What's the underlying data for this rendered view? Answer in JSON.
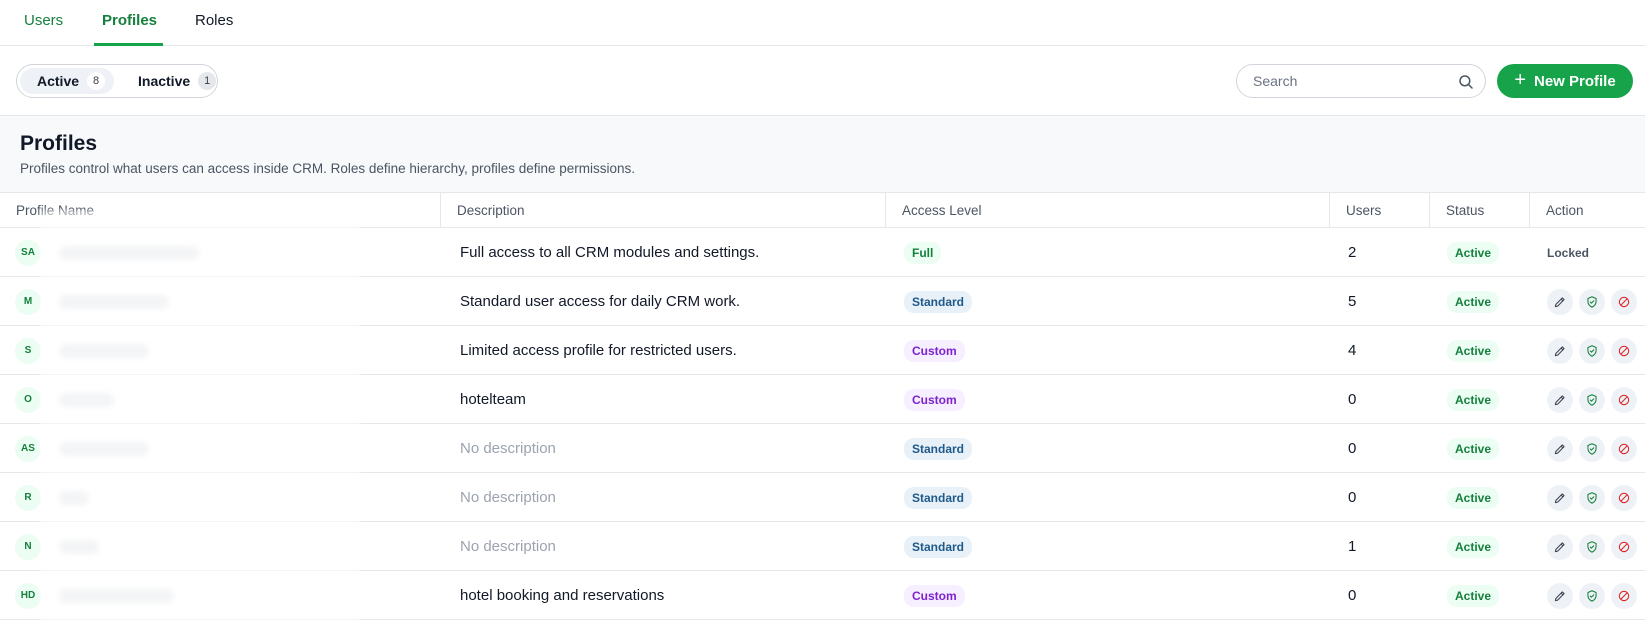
{
  "top_tabs": [
    {
      "label": "Users"
    },
    {
      "label": "Profiles"
    },
    {
      "label": "Roles"
    }
  ],
  "filters": {
    "active_label": "Active",
    "active_count": "8",
    "inactive_label": "Inactive",
    "inactive_count": "1"
  },
  "search": {
    "placeholder": "Search",
    "icon": "search-icon"
  },
  "new_profile_button": {
    "label": "New Profile",
    "icon": "plus-icon"
  },
  "section": {
    "title": "Profiles",
    "subtitle": "Profiles control what users can access inside CRM. Roles define hierarchy, profiles define permissions."
  },
  "table": {
    "headers": [
      "Profile Name",
      "Description",
      "Access Level",
      "Users",
      "Status",
      "Action"
    ],
    "rows": [
      {
        "initials": "SA",
        "description": "Full access to all CRM modules and settings.",
        "desc_empty": false,
        "access": "Full",
        "access_kind": "full",
        "users": "2",
        "status": "Active",
        "locked": true,
        "locked_label": "Locked"
      },
      {
        "initials": "M",
        "description": "Standard user access for daily CRM work.",
        "desc_empty": false,
        "access": "Standard",
        "access_kind": "standard",
        "users": "5",
        "status": "Active",
        "locked": false
      },
      {
        "initials": "S",
        "description": "Limited access profile for restricted users.",
        "desc_empty": false,
        "access": "Custom",
        "access_kind": "custom",
        "users": "4",
        "status": "Active",
        "locked": false
      },
      {
        "initials": "O",
        "description": "hotelteam",
        "desc_empty": false,
        "access": "Custom",
        "access_kind": "custom",
        "users": "0",
        "status": "Active",
        "locked": false
      },
      {
        "initials": "AS",
        "description": "No description",
        "desc_empty": true,
        "access": "Standard",
        "access_kind": "standard",
        "users": "0",
        "status": "Active",
        "locked": false
      },
      {
        "initials": "R",
        "description": "No description",
        "desc_empty": true,
        "access": "Standard",
        "access_kind": "standard",
        "users": "0",
        "status": "Active",
        "locked": false
      },
      {
        "initials": "N",
        "description": "No description",
        "desc_empty": true,
        "access": "Standard",
        "access_kind": "standard",
        "users": "1",
        "status": "Active",
        "locked": false
      },
      {
        "initials": "HD",
        "description": "hotel booking and reservations",
        "desc_empty": false,
        "access": "Custom",
        "access_kind": "custom",
        "users": "0",
        "status": "Active",
        "locked": false
      }
    ]
  },
  "action_icons": [
    "pencil-icon",
    "shield-check-icon",
    "ban-icon"
  ],
  "colors": {
    "accent": "#16a34a",
    "accent_text": "#15803d",
    "standard_badge": "#1e5a8a",
    "custom_badge": "#7e22ce",
    "danger": "#dc2626"
  }
}
